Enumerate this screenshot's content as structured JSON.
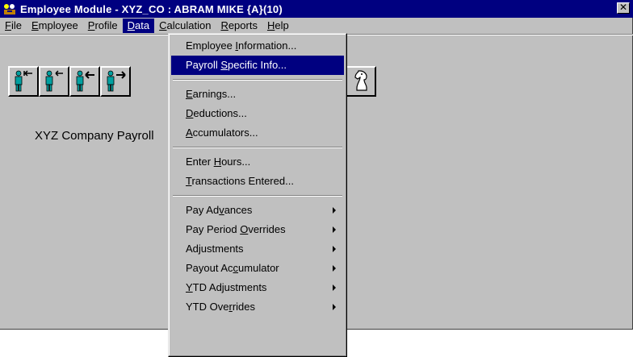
{
  "window": {
    "title": "Employee Module - XYZ_CO : ABRAM MIKE {A}(10)",
    "close_label": "✕"
  },
  "menubar": {
    "items": [
      {
        "label": "File"
      },
      {
        "label": "Employee"
      },
      {
        "label": "Profile"
      },
      {
        "label": "Data"
      },
      {
        "label": "Calculation"
      },
      {
        "label": "Reports"
      },
      {
        "label": "Help"
      }
    ]
  },
  "main": {
    "company_label": "XYZ Company Payroll"
  },
  "toolbar": {
    "icons": [
      "first-employee-icon",
      "previous-employee-icon",
      "back-arrow-icon",
      "next-employee-icon",
      "horse-icon"
    ]
  },
  "data_menu": {
    "group1": [
      {
        "pre": "Employee ",
        "ul": "I",
        "post": "nformation..."
      },
      {
        "pre": "Payroll ",
        "ul": "S",
        "post": "pecific Info..."
      }
    ],
    "group2": [
      {
        "pre": "",
        "ul": "E",
        "post": "arnings..."
      },
      {
        "pre": "",
        "ul": "D",
        "post": "eductions..."
      },
      {
        "pre": "",
        "ul": "A",
        "post": "ccumulators..."
      }
    ],
    "group3": [
      {
        "pre": "Enter ",
        "ul": "H",
        "post": "ours..."
      },
      {
        "pre": "",
        "ul": "T",
        "post": "ransactions Entered..."
      }
    ],
    "group4": [
      {
        "pre": "Pay Ad",
        "ul": "v",
        "post": "ances"
      },
      {
        "pre": "Pay Period ",
        "ul": "O",
        "post": "verrides"
      },
      {
        "pre": "Adjustments",
        "ul": "",
        "post": ""
      },
      {
        "pre": "Payout Ac",
        "ul": "c",
        "post": "umulator"
      },
      {
        "pre": "",
        "ul": "Y",
        "post": "TD Adjustments"
      },
      {
        "pre": "YTD Ove",
        "ul": "r",
        "post": "rides"
      }
    ]
  },
  "colors": {
    "titlebar": "#000080",
    "face": "#c0c0c0",
    "highlight": "#000080"
  }
}
